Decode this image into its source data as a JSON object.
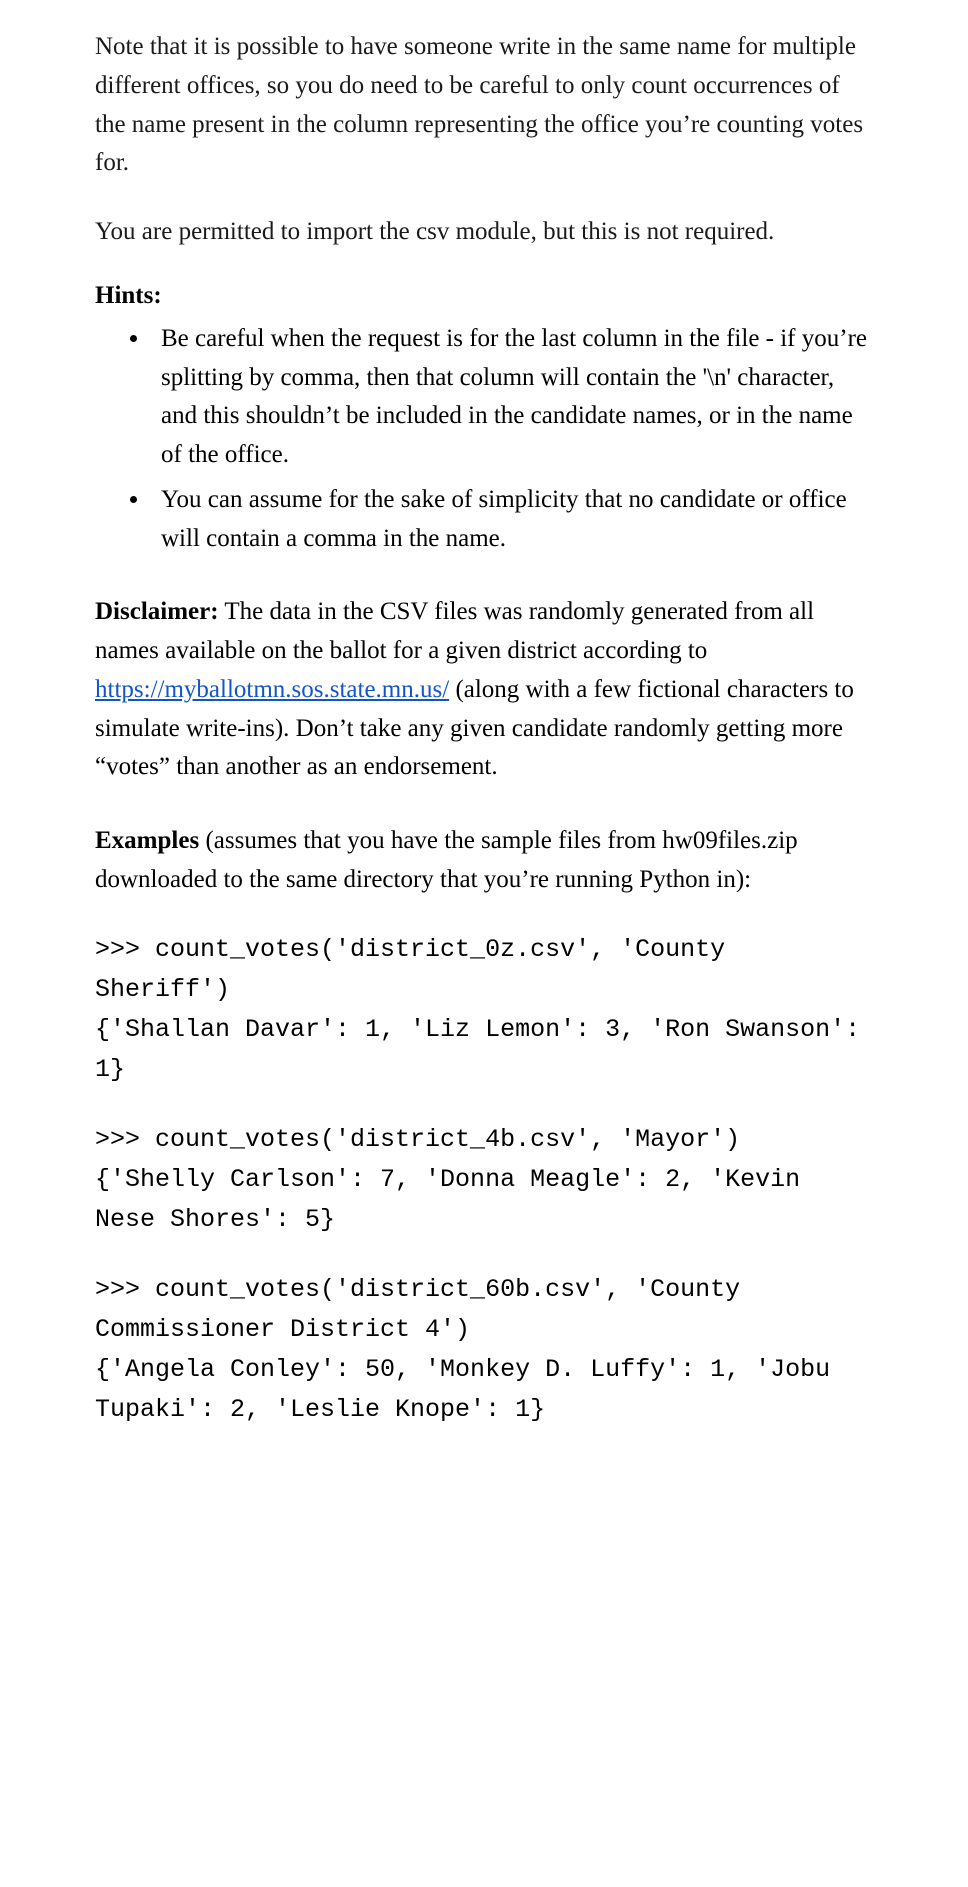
{
  "para1": "Note that it is possible to have someone write in the same name for multiple different offices, so you do need to be careful to only count occurrences of the name present in the column representing the office you’re counting votes for.",
  "para2": "You are permitted to import the csv module, but this is not required.",
  "hints_heading": "Hints:",
  "hints": [
    "Be careful when the request is for the last column in the file - if you’re splitting by comma, then that column will contain the '\\n' character, and this shouldn’t be included in the candidate names, or in the name of the office.",
    "You can assume for the sake of simplicity that no candidate or office will contain a comma in the name."
  ],
  "disclaimer_label": "Disclaimer:",
  "disclaimer_before": " The data in the CSV files was randomly generated from all names available on the ballot for a given district according to ",
  "disclaimer_link_text": "https://myballotmn.sos.state.mn.us/",
  "disclaimer_link_href": "https://myballotmn.sos.state.mn.us/",
  "disclaimer_after": " (along with a few fictional characters to simulate write-ins).  Don’t take any given candidate randomly getting more “votes” than another as an endorsement.",
  "examples_label": "Examples",
  "examples_intro": " (assumes that you have the sample files from hw09files.zip downloaded to the same directory that you’re running Python in):",
  "code1": ">>> count_votes('district_0z.csv', 'County Sheriff')\n{'Shallan Davar': 1, 'Liz Lemon': 3, 'Ron Swanson': 1}",
  "code2": ">>> count_votes('district_4b.csv', 'Mayor')\n{'Shelly Carlson': 7, 'Donna Meagle': 2, 'Kevin Nese Shores': 5}",
  "code3": ">>> count_votes('district_60b.csv', 'County Commissioner District 4')\n{'Angela Conley': 50, 'Monkey D. Luffy': 1, 'Jobu Tupaki': 2, 'Leslie Knope': 1}"
}
